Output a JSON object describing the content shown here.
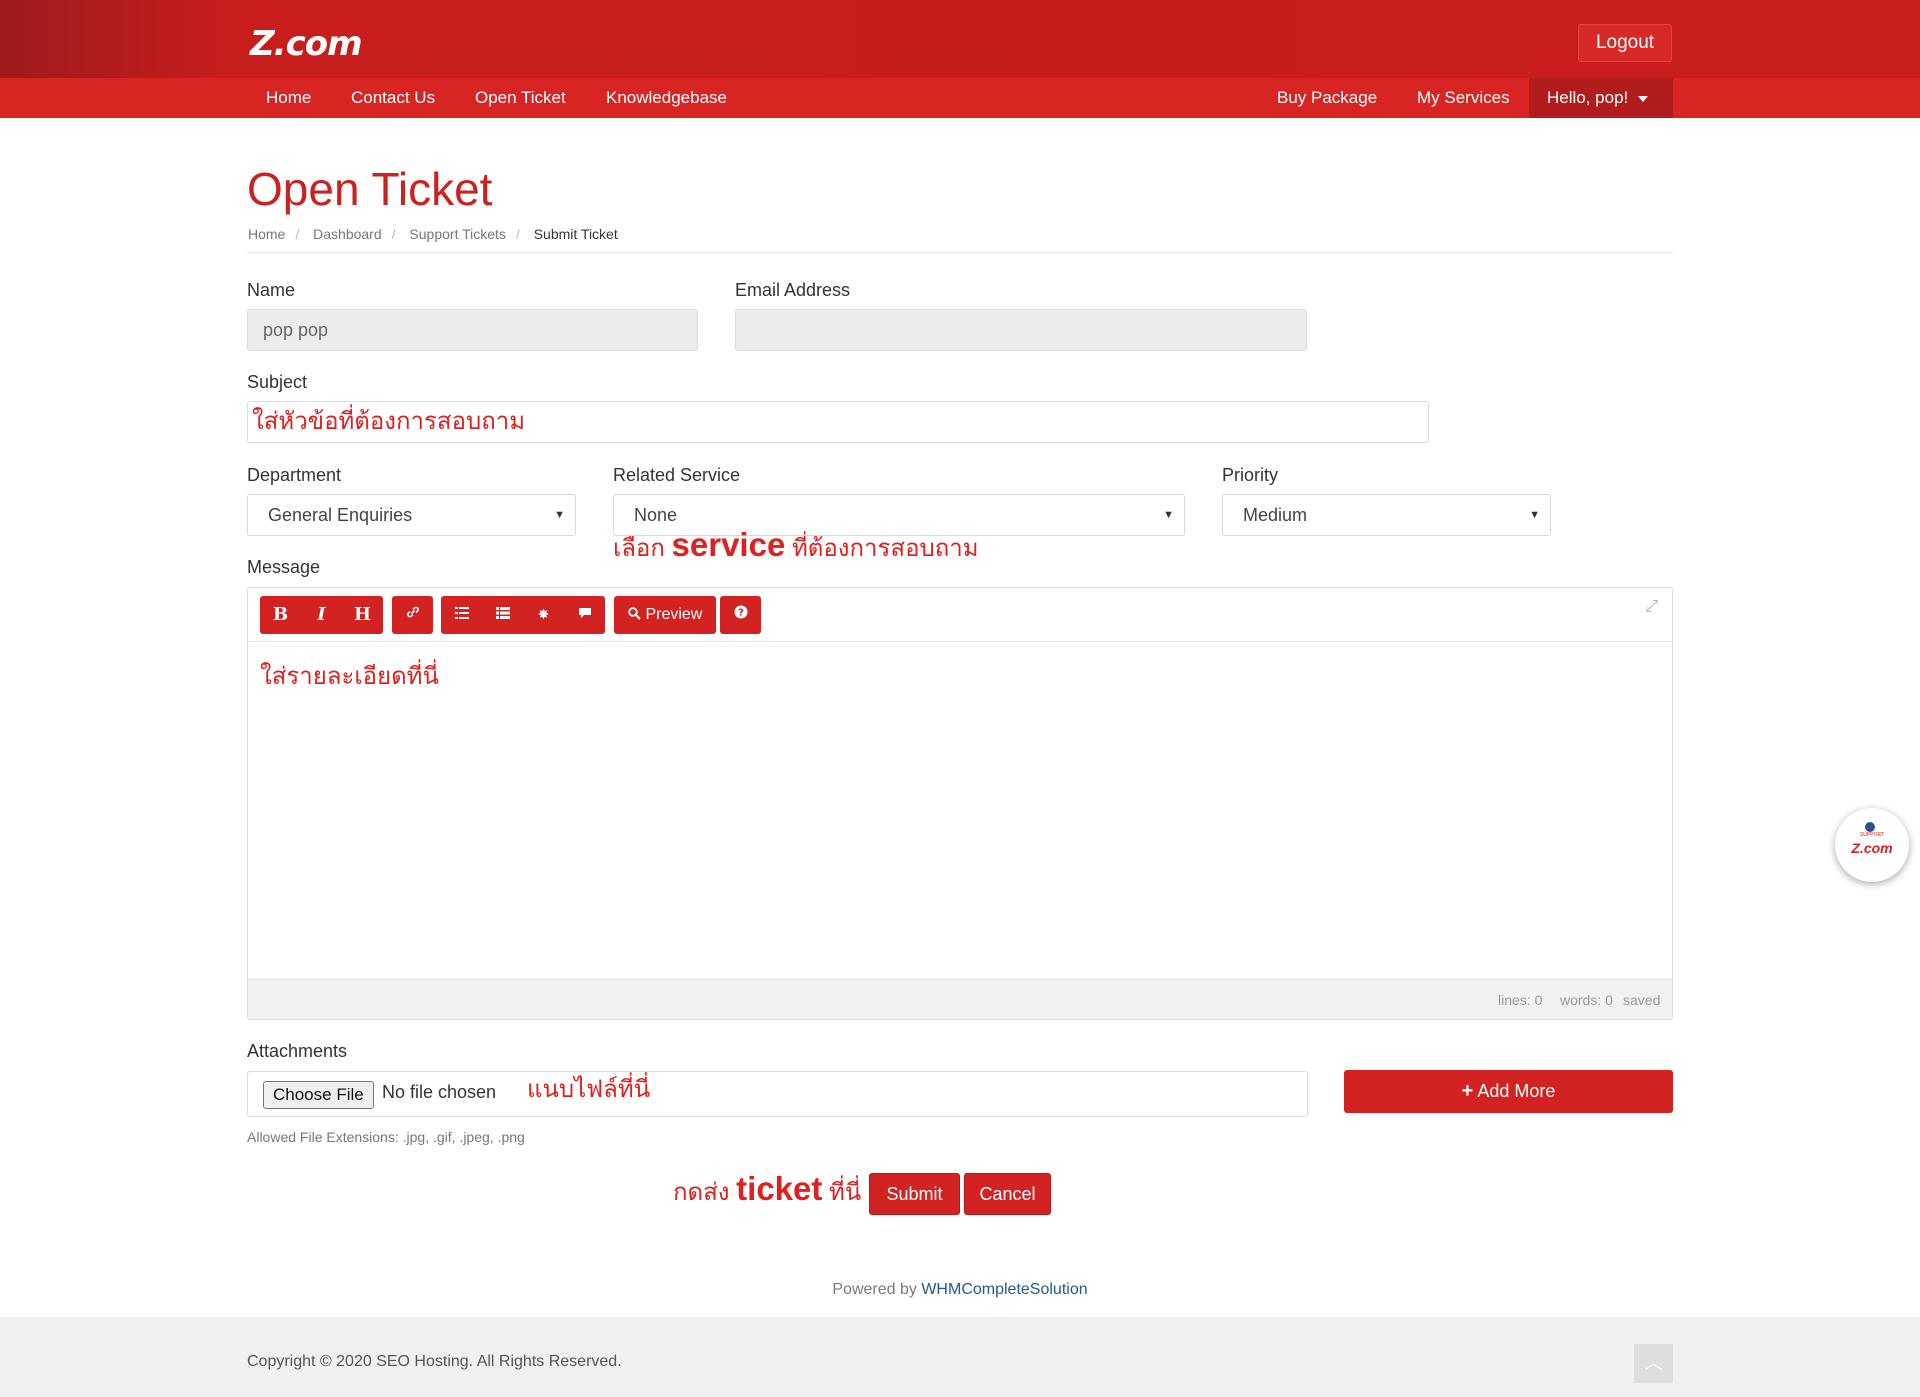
{
  "header": {
    "logo": "Z.com",
    "logout_label": "Logout"
  },
  "nav": {
    "left": [
      "Home",
      "Contact Us",
      "Open Ticket",
      "Knowledgebase"
    ],
    "right": [
      "Buy Package",
      "My Services"
    ],
    "user_menu": "Hello, pop!"
  },
  "page": {
    "title": "Open Ticket",
    "breadcrumb": [
      "Home",
      "Dashboard",
      "Support Tickets",
      "Submit Ticket"
    ]
  },
  "form": {
    "name_label": "Name",
    "name_value": "pop pop",
    "email_label": "Email Address",
    "email_value": "",
    "subject_label": "Subject",
    "subject_value": "ใส่หัวข้อที่ต้องการสอบถาม",
    "department_label": "Department",
    "department_value": "General Enquiries",
    "related_service_label": "Related Service",
    "related_service_value": "None",
    "priority_label": "Priority",
    "priority_value": "Medium",
    "message_label": "Message",
    "message_value": "ใส่รายละเอียดที่นี่",
    "attachments_label": "Attachments",
    "choose_file_label": "Choose File",
    "no_file_label": "No file chosen",
    "add_more_label": "Add More",
    "allowed_extensions": "Allowed File Extensions: .jpg, .gif, .jpeg, .png",
    "submit_label": "Submit",
    "cancel_label": "Cancel"
  },
  "editor": {
    "toolbar": [
      "B",
      "I",
      "H"
    ],
    "preview_label": "Preview",
    "status": {
      "lines": "lines: 0",
      "words": "words: 0",
      "saved": "saved"
    }
  },
  "annotations": {
    "service_pre": "เลือก",
    "service_bold": "service",
    "service_post": "ที่ต้องการสอบถาม",
    "attach": "แนบไฟล์ที่นี่",
    "submit_pre": "กดส่ง",
    "submit_bold": "ticket",
    "submit_post": "ที่นี่"
  },
  "footer": {
    "powered_prefix": "Powered by",
    "powered_link": "WHMCompleteSolution",
    "copyright": "Copyright © 2020 SEO Hosting. All Rights Reserved."
  },
  "support_widget": {
    "small": "SUPPORT",
    "logo": "Z.com"
  },
  "colors": {
    "brand_red": "#d32222",
    "header_dark": "#9e1b1b",
    "annotation_red": "#e01f1f",
    "link_blue": "#1f5a8a"
  },
  "icons": [
    "bold",
    "italic",
    "heading",
    "link",
    "unordered-list",
    "ordered-list",
    "image",
    "quote",
    "search",
    "help",
    "expand",
    "plus",
    "caret-down",
    "chevron-up"
  ]
}
